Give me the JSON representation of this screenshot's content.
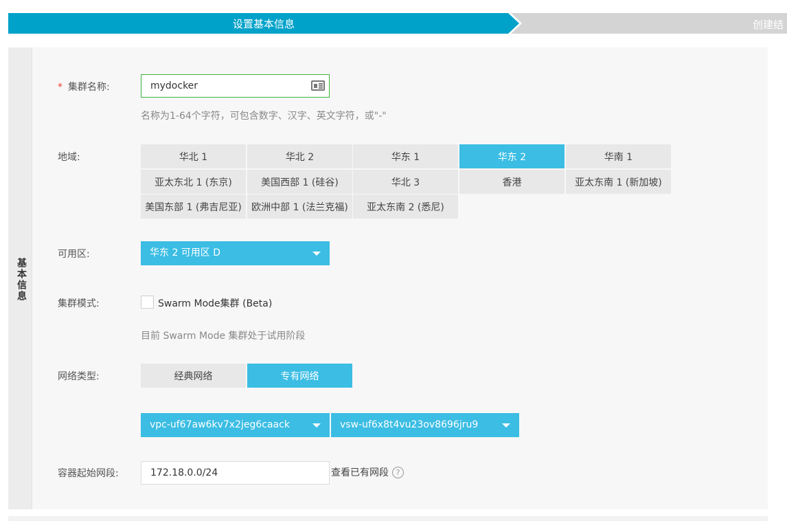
{
  "steps": {
    "step1": "设置基本信息",
    "step2": "创建结"
  },
  "section": {
    "side_tab": "基本信息"
  },
  "cluster_name": {
    "required_mark": "*",
    "label": "集群名称:",
    "value": "mydocker",
    "hint": "名称为1-64个字符，可包含数字、汉字、英文字符，或\"-\""
  },
  "region": {
    "label": "地域:",
    "options": [
      "华北 1",
      "华北 2",
      "华东 1",
      "华东 2",
      "华南 1",
      "亚太东北 1 (东京)",
      "美国西部 1 (硅谷)",
      "华北 3",
      "香港",
      "亚太东南 1 (新加坡)",
      "美国东部 1 (弗吉尼亚)",
      "欧洲中部 1 (法兰克福)",
      "亚太东南 2 (悉尼)"
    ],
    "selected": "华东 2"
  },
  "zone": {
    "label": "可用区:",
    "selected": "华东 2 可用区 D"
  },
  "cluster_mode": {
    "label": "集群模式:",
    "checkbox_label": "Swarm Mode集群 (Beta)",
    "checked": false,
    "hint": "目前 Swarm Mode 集群处于试用阶段"
  },
  "network": {
    "label": "网络类型:",
    "options": [
      "经典网络",
      "专有网络"
    ],
    "selected": "专有网络",
    "vpc": "vpc-uf67aw6kv7x2jeg6caack",
    "vswitch": "vsw-uf6x8t4vu23ov8696jru9"
  },
  "container_cidr": {
    "label": "容器起始网段:",
    "value": "172.18.0.0/24",
    "link": "查看已有网段",
    "help_icon": "?"
  },
  "colors": {
    "primary": "#00a2ca",
    "selected": "#3bbde4",
    "inactive_step": "#d4d4d4",
    "required": "#e8402d",
    "focus_border": "#3ab53a"
  }
}
